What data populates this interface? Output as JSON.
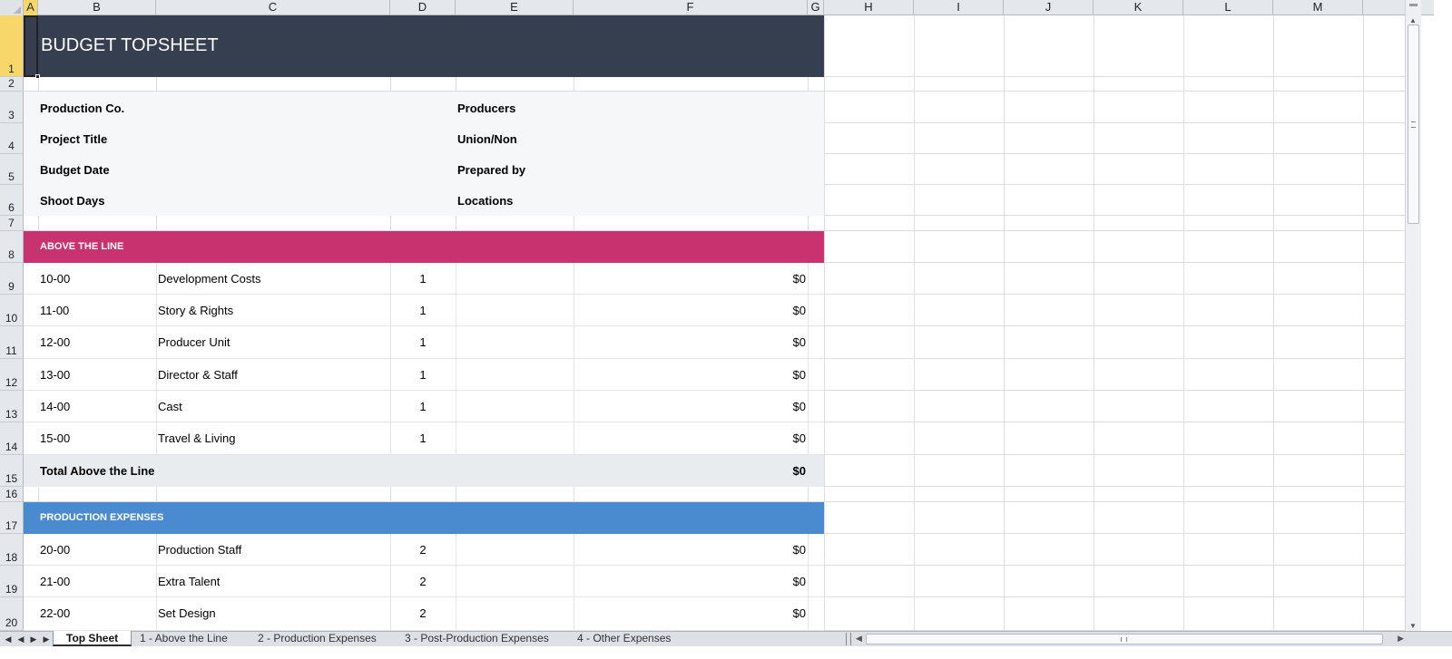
{
  "columns": [
    "A",
    "B",
    "C",
    "D",
    "E",
    "F",
    "G",
    "H",
    "I",
    "J",
    "K",
    "L",
    "M"
  ],
  "rows": [
    "1",
    "2",
    "3",
    "4",
    "5",
    "6",
    "7",
    "8",
    "9",
    "10",
    "11",
    "12",
    "13",
    "14",
    "15",
    "16",
    "17",
    "18",
    "19",
    "20"
  ],
  "title": "BUDGET TOPSHEET",
  "info": {
    "production_co": "Production Co.",
    "project_title": "Project Title",
    "budget_date": "Budget Date",
    "shoot_days": "Shoot Days",
    "producers": "Producers",
    "union_non": "Union/Non",
    "prepared_by": "Prepared by",
    "locations": "Locations"
  },
  "above_the_line": {
    "header": "ABOVE THE LINE",
    "items": [
      {
        "acct": "10-00",
        "desc": "Development Costs",
        "qty": "1",
        "amount": "$0"
      },
      {
        "acct": "11-00",
        "desc": "Story & Rights",
        "qty": "1",
        "amount": "$0"
      },
      {
        "acct": "12-00",
        "desc": "Producer Unit",
        "qty": "1",
        "amount": "$0"
      },
      {
        "acct": "13-00",
        "desc": "Director & Staff",
        "qty": "1",
        "amount": "$0"
      },
      {
        "acct": "14-00",
        "desc": "Cast",
        "qty": "1",
        "amount": "$0"
      },
      {
        "acct": "15-00",
        "desc": "Travel & Living",
        "qty": "1",
        "amount": "$0"
      }
    ],
    "total_label": "Total Above the Line",
    "total_amount": "$0"
  },
  "production_expenses": {
    "header": "PRODUCTION EXPENSES",
    "items": [
      {
        "acct": "20-00",
        "desc": "Production Staff",
        "qty": "2",
        "amount": "$0"
      },
      {
        "acct": "21-00",
        "desc": "Extra Talent",
        "qty": "2",
        "amount": "$0"
      },
      {
        "acct": "22-00",
        "desc": "Set Design",
        "qty": "2",
        "amount": "$0"
      }
    ]
  },
  "tabs": [
    "Top Sheet",
    "1 - Above the Line",
    "2 - Production Expenses",
    "3 - Post-Production Expenses",
    "4 - Other Expenses"
  ],
  "active_tab": "Top Sheet",
  "colors": {
    "title_bg": "#363f4f",
    "above_line_bg": "#c8326e",
    "production_bg": "#4a8bd0",
    "info_bg": "#f6f7f9",
    "total_bg": "#e9ecef",
    "selection": "#f7d769"
  },
  "icons": {
    "nav_first": "◀",
    "nav_last": "▶",
    "scroll_up": "▲",
    "scroll_down": "▼"
  }
}
